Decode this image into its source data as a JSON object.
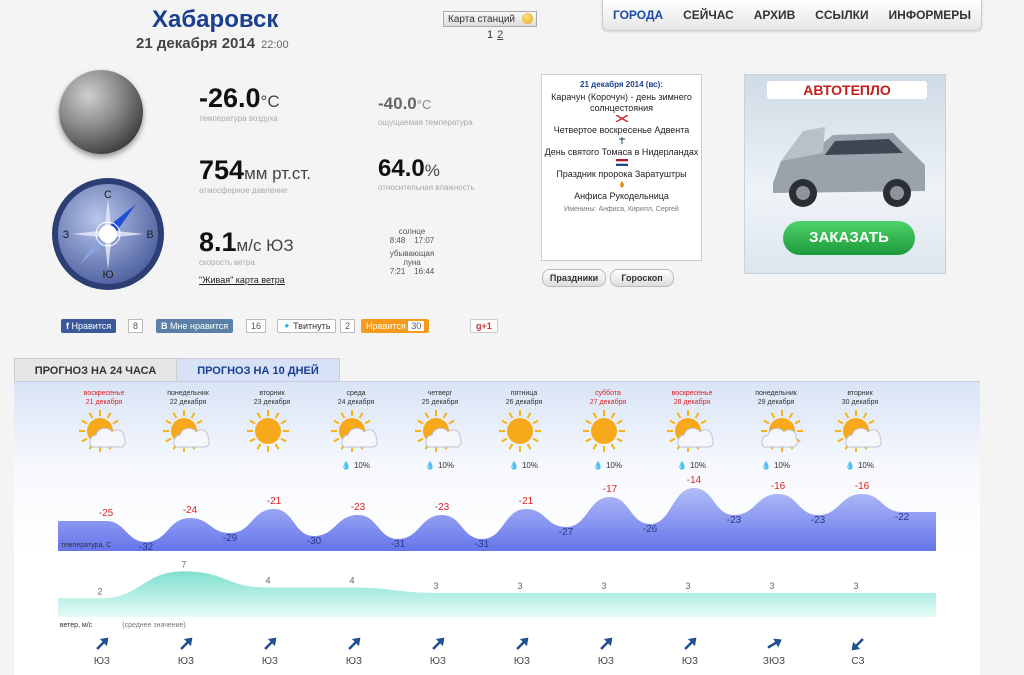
{
  "header": {
    "city": "Хабаровск",
    "date": "21 декабря 2014",
    "time": "22:00",
    "station_map_label": "Карта станций",
    "pages": [
      "1",
      "2"
    ]
  },
  "nav": {
    "items": [
      "ГОРОДА",
      "СЕЙЧАС",
      "АРХИВ",
      "ССЫЛКИ",
      "ИНФОРМЕРЫ"
    ],
    "active": "ГОРОДА"
  },
  "current": {
    "temperature": {
      "value": "-26.0",
      "unit": "°C",
      "label": "температура воздуха"
    },
    "feels_like": {
      "value": "-40.0",
      "unit": "°C",
      "label": "ощущаемая температура"
    },
    "pressure": {
      "value": "754",
      "unit": "мм рт.ст.",
      "label": "атмосферное давление"
    },
    "humidity": {
      "value": "64.0",
      "unit": "%",
      "label": "относительная влажность"
    },
    "wind": {
      "value": "8.1",
      "unit": "м/с ЮЗ",
      "label": "скорость ветра",
      "map_link": "\"Живая\" карта ветра"
    },
    "compass": {
      "n": "С",
      "s": "Ю",
      "w": "З",
      "e": "В"
    },
    "sun": {
      "label": "солнце",
      "rise": "8:48",
      "set": "17:07"
    },
    "moon": {
      "label1": "убывающая",
      "label2": "луна",
      "rise": "7:21",
      "set": "16:44"
    }
  },
  "holidays": {
    "header": "21 декабря 2014 (вс):",
    "items": [
      "Карачун (Корочун) - день зимнего солнцестояния",
      "Четвертое воскресенье Адвента",
      "День святого Томаса в Нидерландах",
      "Праздник пророка Заратуштры",
      "Анфиса Рукодельница"
    ],
    "names": "Именины: Анфиса, Кирилл, Сергей",
    "btn_holidays": "Праздники",
    "btn_horoscope": "Гороскоп"
  },
  "ad": {
    "brand": "АВТОТЕПЛО",
    "order": "ЗАКАЗАТЬ"
  },
  "social": {
    "fb": "Нравится",
    "fb_count": "8",
    "vk": "Мне нравится",
    "vk_count": "16",
    "tw": "Твитнуть",
    "tw_count": "2",
    "ok": "Нравится",
    "ok_count": "30",
    "gp": "g+1"
  },
  "tabs": [
    "ПРОГНОЗ НА 24 ЧАСА",
    "ПРОГНОЗ НА 10 ДНЕЙ"
  ],
  "forecast": {
    "days": [
      {
        "dow": "воскресенье",
        "date": "21 декабря",
        "red": true,
        "icon": "sun-cloud",
        "precip": ""
      },
      {
        "dow": "понедельник",
        "date": "22 декабря",
        "red": false,
        "icon": "sun-cloud",
        "precip": ""
      },
      {
        "dow": "вторник",
        "date": "23 декабря",
        "red": false,
        "icon": "sun",
        "precip": ""
      },
      {
        "dow": "среда",
        "date": "24 декабря",
        "red": false,
        "icon": "sun-cloud",
        "precip": "10%"
      },
      {
        "dow": "четверг",
        "date": "25 декабря",
        "red": false,
        "icon": "sun-cloud",
        "precip": "10%"
      },
      {
        "dow": "пятница",
        "date": "26 декабря",
        "red": false,
        "icon": "sun",
        "precip": "10%"
      },
      {
        "dow": "суббота",
        "date": "27 декабря",
        "red": true,
        "icon": "sun",
        "precip": "10%"
      },
      {
        "dow": "воскресенье",
        "date": "28 декабря",
        "red": true,
        "icon": "sun-cloud",
        "precip": "10%"
      },
      {
        "dow": "понедельник",
        "date": "29 декабря",
        "red": false,
        "icon": "cloud-sun",
        "precip": "10%"
      },
      {
        "dow": "вторник",
        "date": "30 декабря",
        "red": false,
        "icon": "sun-cloud",
        "precip": "10%"
      }
    ],
    "temp_label": "температура, С",
    "wind_label": "ветер, м/с",
    "wind_note": "(среднее значение)"
  },
  "chart_data": [
    {
      "type": "area",
      "ylabel": "температура, С",
      "categories": [
        "21 декабря",
        "22 декабря",
        "23 декабря",
        "24 декабря",
        "25 декабря",
        "26 декабря",
        "27 декабря",
        "28 декабря",
        "29 декабря",
        "30 декабря"
      ],
      "series": [
        {
          "values": [
            -25,
            -24,
            -21,
            -23,
            -23,
            -21,
            -17,
            -14,
            -16,
            -16
          ]
        },
        {
          "values": [
            -32,
            -29,
            -30,
            -31,
            -31,
            -27,
            -26,
            -23,
            -23,
            -22
          ]
        }
      ]
    },
    {
      "type": "area",
      "ylabel": "ветер, м/с",
      "categories": [
        "21 декабря",
        "22 декабря",
        "23 декабря",
        "24 декабря",
        "25 декабря",
        "26 декабря",
        "27 декабря",
        "28 декабря",
        "29 декабря",
        "30 декабря"
      ],
      "values": [
        2,
        7,
        4,
        4,
        3,
        3,
        3,
        3,
        3,
        3
      ],
      "directions": [
        "ЮЗ",
        "ЮЗ",
        "ЮЗ",
        "ЮЗ",
        "ЮЗ",
        "ЮЗ",
        "ЮЗ",
        "ЮЗ",
        "ЗЮЗ",
        "СЗ"
      ]
    }
  ],
  "colors": {
    "accent": "#1a3f8f",
    "red": "#dd2222",
    "temp_fill": "#6f7ff0",
    "wind_fill": "#8fe3d6"
  }
}
